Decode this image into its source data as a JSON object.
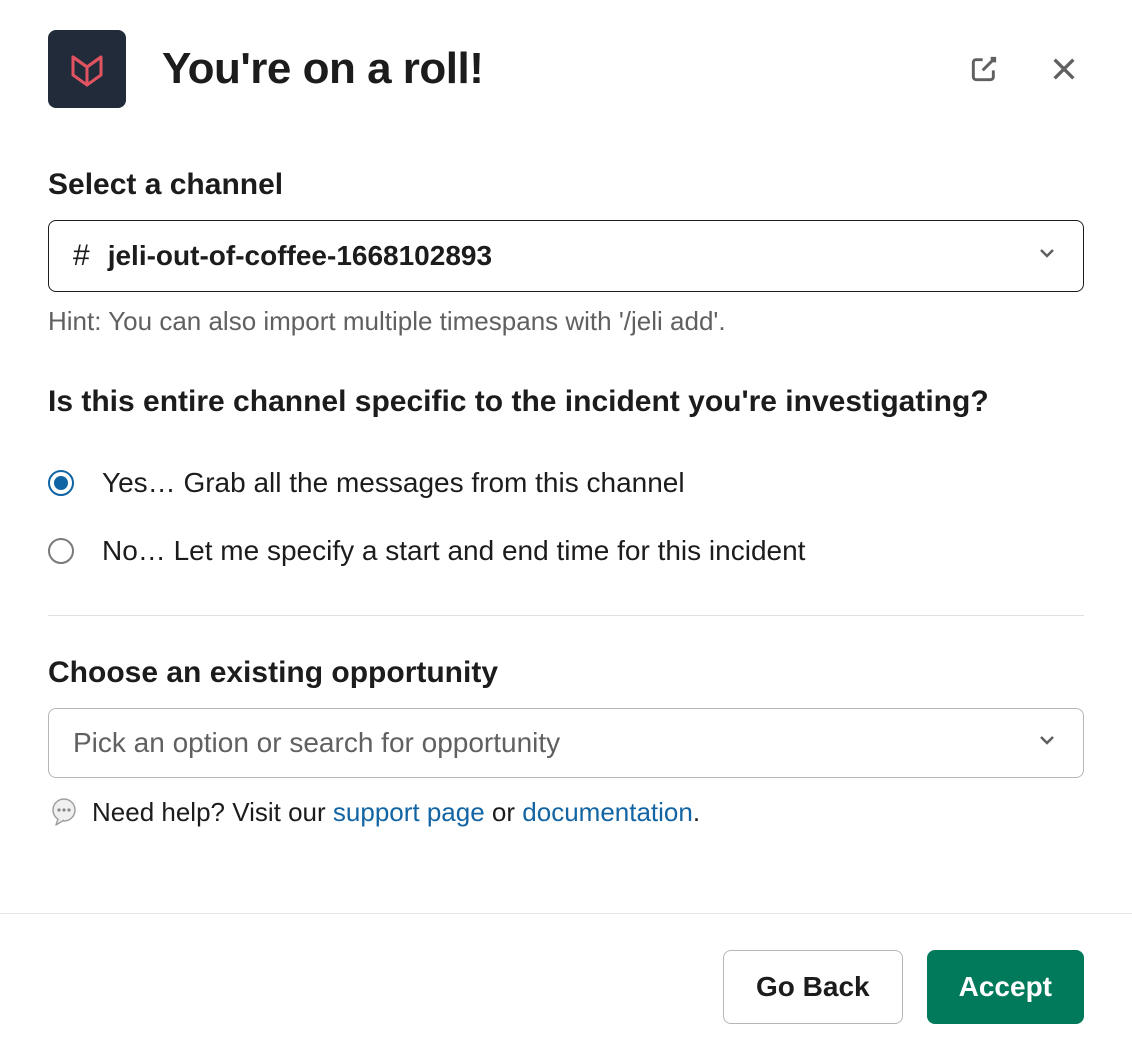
{
  "header": {
    "title": "You're on a roll!"
  },
  "channel_section": {
    "label": "Select a channel",
    "selected": "jeli-out-of-coffee-1668102893",
    "hint": "Hint: You can also import multiple timespans with '/jeli add'."
  },
  "question": "Is this entire channel specific to the incident you're investigating?",
  "radio_options": {
    "yes": "Yes… Grab all the messages from this channel",
    "no": "No… Let me specify a start and end time for this incident",
    "selected": "yes"
  },
  "opportunity_section": {
    "label": "Choose an existing opportunity",
    "placeholder": "Pick an option or search for opportunity"
  },
  "helper": {
    "prefix": "Need help? Visit our ",
    "link1": "support page",
    "middle": " or ",
    "link2": "documentation",
    "suffix": "."
  },
  "footer": {
    "back": "Go Back",
    "accept": "Accept"
  }
}
